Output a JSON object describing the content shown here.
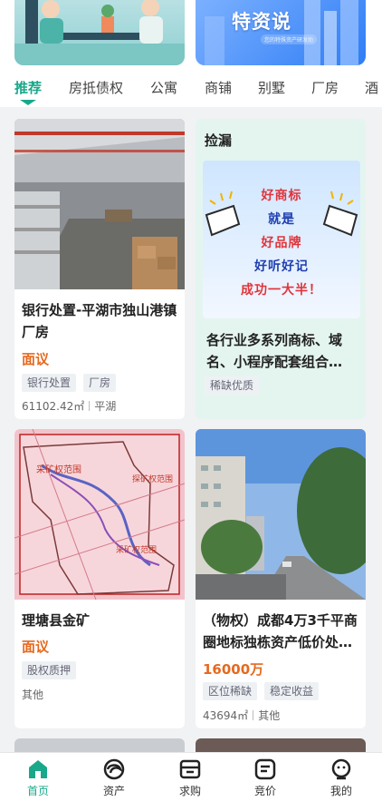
{
  "banners": {
    "right_title": "特资说",
    "right_subtitle": "您的特殊资产研发助"
  },
  "tabs": [
    {
      "label": "推荐",
      "active": true
    },
    {
      "label": "房抵债权"
    },
    {
      "label": "公寓"
    },
    {
      "label": "商铺"
    },
    {
      "label": "别墅"
    },
    {
      "label": "厂房"
    },
    {
      "label": "酒"
    }
  ],
  "cards": [
    {
      "title": "银行处置-平湖市独山港镇厂房",
      "price": "面议",
      "tags": [
        "银行处置",
        "厂房"
      ],
      "area": "61102.42㎡",
      "location": "平湖"
    },
    {
      "heading": "捡漏",
      "promo_lines": [
        "好商标",
        "就是",
        "好品牌",
        "好听好记",
        "成功一大半！"
      ],
      "title": "各行业多系列商标、域名、小程序配套组合…",
      "tags": [
        "稀缺优质"
      ]
    },
    {
      "title": "理塘县金矿",
      "price": "面议",
      "tags": [
        "股权质押"
      ],
      "location": "其他",
      "map_labels": [
        "采矿权范围",
        "探矿权范围",
        "采矿权范围"
      ]
    },
    {
      "title": "（物权）成都4万3千平商圈地标独栋资产低价处…",
      "price": "16000万",
      "tags": [
        "区位稀缺",
        "稳定收益"
      ],
      "area": "43694㎡",
      "location": "其他"
    }
  ],
  "bottom_nav": [
    {
      "label": "首页",
      "icon": "home-icon",
      "active": true
    },
    {
      "label": "资产",
      "icon": "asset-swirl-icon"
    },
    {
      "label": "求购",
      "icon": "box-icon"
    },
    {
      "label": "竞价",
      "icon": "bid-icon"
    },
    {
      "label": "我的",
      "icon": "profile-icon"
    }
  ],
  "colors": {
    "accent": "#1aa88a",
    "price": "#e6691f",
    "promo_bg": "#e4f5f0"
  }
}
